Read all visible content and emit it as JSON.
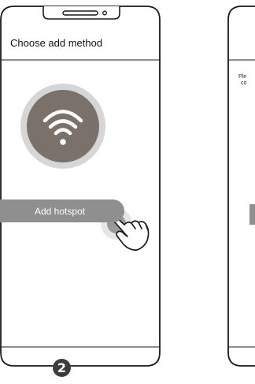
{
  "left_phone": {
    "title": "Choose add method",
    "hotspot_button_label": "Add hotspot"
  },
  "right_phone": {
    "partial_text_line1": "Ple",
    "partial_text_line2": "co"
  },
  "step_number": "2",
  "colors": {
    "frame": "#1a1a1a",
    "wifi_circle": "#7b716b",
    "wifi_ring": "#d4d4d4",
    "button": "#8f8f8f",
    "finger_glow": "#9a9a9a"
  },
  "icons": {
    "wifi": "wifi-icon",
    "hand": "hand-pointer-icon"
  }
}
